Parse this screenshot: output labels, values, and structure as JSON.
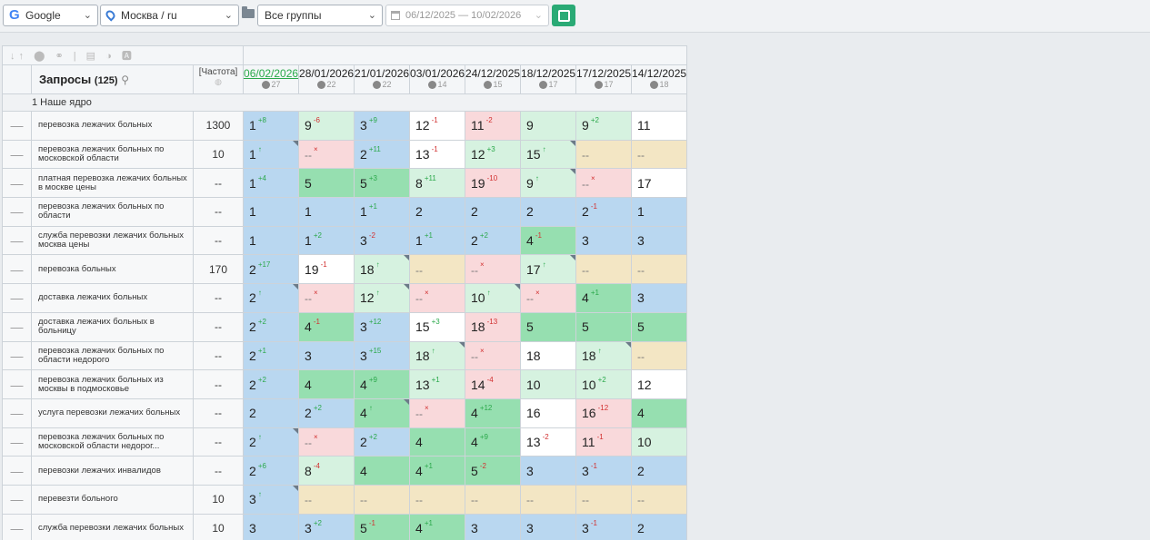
{
  "toolbar": {
    "engine": "Google",
    "region": "Москва / ru",
    "group": "Все группы",
    "date_range": "06/12/2025 — 10/02/2026"
  },
  "table": {
    "query_header": "Запросы",
    "query_count": "(125)",
    "freq_header": "[Частота]",
    "dates": [
      {
        "label": "06/02/2026",
        "count": "27"
      },
      {
        "label": "28/01/2026",
        "count": "22"
      },
      {
        "label": "21/01/2026",
        "count": "22"
      },
      {
        "label": "03/01/2026",
        "count": "14"
      },
      {
        "label": "24/12/2025",
        "count": "15"
      },
      {
        "label": "18/12/2025",
        "count": "17"
      },
      {
        "label": "17/12/2025",
        "count": "17"
      },
      {
        "label": "14/12/2025",
        "count": "18"
      }
    ],
    "group_name": "1 Наше ядро",
    "rows": [
      {
        "kw": "перевозка лежачих больных",
        "freq": "1300",
        "cells": [
          [
            "1",
            "+8",
            "up",
            "c-blue",
            0
          ],
          [
            "9",
            "-6",
            "down",
            "c-lgreen",
            0
          ],
          [
            "3",
            "+9",
            "up",
            "c-blue",
            0
          ],
          [
            "12",
            "-1",
            "down",
            "c-white",
            0
          ],
          [
            "11",
            "-2",
            "down",
            "c-pink",
            0
          ],
          [
            "9",
            "",
            "",
            "c-lgreen",
            0
          ],
          [
            "9",
            "+2",
            "up",
            "c-lgreen",
            0
          ],
          [
            "11",
            "",
            "",
            "c-white",
            0
          ]
        ]
      },
      {
        "kw": "перевозка лежачих больных по московской области",
        "freq": "10",
        "cells": [
          [
            "1",
            "↑",
            "up",
            "c-blue",
            1
          ],
          [
            "--",
            "×",
            "down",
            "c-pink",
            0
          ],
          [
            "2",
            "+11",
            "up",
            "c-blue",
            0
          ],
          [
            "13",
            "-1",
            "down",
            "c-white",
            0
          ],
          [
            "12",
            "+3",
            "up",
            "c-lgreen",
            0
          ],
          [
            "15",
            "↑",
            "up",
            "c-lgreen",
            1
          ],
          [
            "--",
            "",
            "",
            "c-beige",
            0
          ],
          [
            "--",
            "",
            "",
            "c-beige",
            0
          ]
        ]
      },
      {
        "kw": "платная перевозка лежачих больных в москве цены",
        "freq": "--",
        "cells": [
          [
            "1",
            "+4",
            "up",
            "c-blue",
            0
          ],
          [
            "5",
            "",
            "",
            "c-green",
            0
          ],
          [
            "5",
            "+3",
            "up",
            "c-green",
            0
          ],
          [
            "8",
            "+11",
            "up",
            "c-lgreen",
            0
          ],
          [
            "19",
            "-10",
            "down",
            "c-pink",
            0
          ],
          [
            "9",
            "↑",
            "up",
            "c-lgreen",
            1
          ],
          [
            "--",
            "×",
            "down",
            "c-pink",
            0
          ],
          [
            "17",
            "",
            "",
            "c-white",
            0
          ]
        ]
      },
      {
        "kw": "перевозка лежачих больных по области",
        "freq": "--",
        "cells": [
          [
            "1",
            "",
            "",
            "c-blue",
            0
          ],
          [
            "1",
            "",
            "",
            "c-blue",
            0
          ],
          [
            "1",
            "+1",
            "up",
            "c-blue",
            0
          ],
          [
            "2",
            "",
            "",
            "c-blue",
            0
          ],
          [
            "2",
            "",
            "",
            "c-blue",
            0
          ],
          [
            "2",
            "",
            "",
            "c-blue",
            0
          ],
          [
            "2",
            "-1",
            "down",
            "c-blue",
            0
          ],
          [
            "1",
            "",
            "",
            "c-blue",
            0
          ]
        ]
      },
      {
        "kw": "служба перевозки лежачих больных москва цены",
        "freq": "--",
        "cells": [
          [
            "1",
            "",
            "",
            "c-blue",
            0
          ],
          [
            "1",
            "+2",
            "up",
            "c-blue",
            0
          ],
          [
            "3",
            "-2",
            "down",
            "c-blue",
            0
          ],
          [
            "1",
            "+1",
            "up",
            "c-blue",
            0
          ],
          [
            "2",
            "+2",
            "up",
            "c-blue",
            0
          ],
          [
            "4",
            "-1",
            "down",
            "c-green",
            0
          ],
          [
            "3",
            "",
            "",
            "c-blue",
            0
          ],
          [
            "3",
            "",
            "",
            "c-blue",
            0
          ]
        ]
      },
      {
        "kw": "перевозка больных",
        "freq": "170",
        "cells": [
          [
            "2",
            "+17",
            "up",
            "c-blue",
            0
          ],
          [
            "19",
            "-1",
            "down",
            "c-white",
            0
          ],
          [
            "18",
            "↑",
            "up",
            "c-lgreen",
            1
          ],
          [
            "--",
            "",
            "",
            "c-beige",
            0
          ],
          [
            "--",
            "×",
            "down",
            "c-pink",
            0
          ],
          [
            "17",
            "↑",
            "up",
            "c-lgreen",
            1
          ],
          [
            "--",
            "",
            "",
            "c-beige",
            0
          ],
          [
            "--",
            "",
            "",
            "c-beige",
            0
          ]
        ]
      },
      {
        "kw": "доставка лежачих больных",
        "freq": "--",
        "cells": [
          [
            "2",
            "↑",
            "up",
            "c-blue",
            1
          ],
          [
            "--",
            "×",
            "down",
            "c-pink",
            0
          ],
          [
            "12",
            "↑",
            "up",
            "c-lgreen",
            1
          ],
          [
            "--",
            "×",
            "down",
            "c-pink",
            0
          ],
          [
            "10",
            "↑",
            "up",
            "c-lgreen",
            1
          ],
          [
            "--",
            "×",
            "down",
            "c-pink",
            0
          ],
          [
            "4",
            "+1",
            "up",
            "c-green",
            0
          ],
          [
            "3",
            "",
            "",
            "c-blue",
            0
          ]
        ]
      },
      {
        "kw": "доставка лежачих больных в больницу",
        "freq": "--",
        "cells": [
          [
            "2",
            "+2",
            "up",
            "c-blue",
            0
          ],
          [
            "4",
            "-1",
            "down",
            "c-green",
            0
          ],
          [
            "3",
            "+12",
            "up",
            "c-blue",
            0
          ],
          [
            "15",
            "+3",
            "up",
            "c-white",
            0
          ],
          [
            "18",
            "-13",
            "down",
            "c-pink",
            0
          ],
          [
            "5",
            "",
            "",
            "c-green",
            0
          ],
          [
            "5",
            "",
            "",
            "c-green",
            0
          ],
          [
            "5",
            "",
            "",
            "c-green",
            0
          ]
        ]
      },
      {
        "kw": "перевозка лежачих больных по области недорого",
        "freq": "--",
        "cells": [
          [
            "2",
            "+1",
            "up",
            "c-blue",
            0
          ],
          [
            "3",
            "",
            "",
            "c-blue",
            0
          ],
          [
            "3",
            "+15",
            "up",
            "c-blue",
            0
          ],
          [
            "18",
            "↑",
            "up",
            "c-lgreen",
            1
          ],
          [
            "--",
            "×",
            "down",
            "c-pink",
            0
          ],
          [
            "18",
            "",
            "",
            "c-white",
            0
          ],
          [
            "18",
            "↑",
            "up",
            "c-lgreen",
            1
          ],
          [
            "--",
            "",
            "",
            "c-beige",
            0
          ]
        ]
      },
      {
        "kw": "перевозка лежачих больных из москвы в подмосковье",
        "freq": "--",
        "cells": [
          [
            "2",
            "+2",
            "up",
            "c-blue",
            0
          ],
          [
            "4",
            "",
            "",
            "c-green",
            0
          ],
          [
            "4",
            "+9",
            "up",
            "c-green",
            0
          ],
          [
            "13",
            "+1",
            "up",
            "c-lgreen",
            0
          ],
          [
            "14",
            "-4",
            "down",
            "c-pink",
            0
          ],
          [
            "10",
            "",
            "",
            "c-lgreen",
            0
          ],
          [
            "10",
            "+2",
            "up",
            "c-lgreen",
            0
          ],
          [
            "12",
            "",
            "",
            "c-white",
            0
          ]
        ]
      },
      {
        "kw": "услуга перевозки лежачих больных",
        "freq": "--",
        "cells": [
          [
            "2",
            "",
            "",
            "c-blue",
            0
          ],
          [
            "2",
            "+2",
            "up",
            "c-blue",
            0
          ],
          [
            "4",
            "↑",
            "up",
            "c-green",
            1
          ],
          [
            "--",
            "×",
            "down",
            "c-pink",
            0
          ],
          [
            "4",
            "+12",
            "up",
            "c-green",
            0
          ],
          [
            "16",
            "",
            "",
            "c-white",
            0
          ],
          [
            "16",
            "-12",
            "down",
            "c-pink",
            0
          ],
          [
            "4",
            "",
            "",
            "c-green",
            0
          ]
        ]
      },
      {
        "kw": "перевозка лежачих больных по московской области недорог...",
        "freq": "--",
        "cells": [
          [
            "2",
            "↑",
            "up",
            "c-blue",
            1
          ],
          [
            "--",
            "×",
            "down",
            "c-pink",
            0
          ],
          [
            "2",
            "+2",
            "up",
            "c-blue",
            0
          ],
          [
            "4",
            "",
            "",
            "c-green",
            0
          ],
          [
            "4",
            "+9",
            "up",
            "c-green",
            0
          ],
          [
            "13",
            "-2",
            "down",
            "c-white",
            0
          ],
          [
            "11",
            "-1",
            "down",
            "c-pink",
            0
          ],
          [
            "10",
            "",
            "",
            "c-lgreen",
            0
          ]
        ]
      },
      {
        "kw": "перевозки лежачих инвалидов",
        "freq": "--",
        "cells": [
          [
            "2",
            "+6",
            "up",
            "c-blue",
            0
          ],
          [
            "8",
            "-4",
            "down",
            "c-lgreen",
            0
          ],
          [
            "4",
            "",
            "",
            "c-green",
            0
          ],
          [
            "4",
            "+1",
            "up",
            "c-green",
            0
          ],
          [
            "5",
            "-2",
            "down",
            "c-green",
            0
          ],
          [
            "3",
            "",
            "",
            "c-blue",
            0
          ],
          [
            "3",
            "-1",
            "down",
            "c-blue",
            0
          ],
          [
            "2",
            "",
            "",
            "c-blue",
            0
          ]
        ]
      },
      {
        "kw": "перевезти больного",
        "freq": "10",
        "cells": [
          [
            "3",
            "↑",
            "up",
            "c-blue",
            1
          ],
          [
            "--",
            "",
            "",
            "c-beige",
            0
          ],
          [
            "--",
            "",
            "",
            "c-beige",
            0
          ],
          [
            "--",
            "",
            "",
            "c-beige",
            0
          ],
          [
            "--",
            "",
            "",
            "c-beige",
            0
          ],
          [
            "--",
            "",
            "",
            "c-beige",
            0
          ],
          [
            "--",
            "",
            "",
            "c-beige",
            0
          ],
          [
            "--",
            "",
            "",
            "c-beige",
            0
          ]
        ]
      },
      {
        "kw": "служба перевозки лежачих больных",
        "freq": "10",
        "cells": [
          [
            "3",
            "",
            "",
            "c-blue",
            0
          ],
          [
            "3",
            "+2",
            "up",
            "c-blue",
            0
          ],
          [
            "5",
            "-1",
            "down",
            "c-green",
            0
          ],
          [
            "4",
            "+1",
            "up",
            "c-green",
            0
          ],
          [
            "3",
            "",
            "",
            "c-blue",
            0
          ],
          [
            "3",
            "",
            "",
            "c-blue",
            0
          ],
          [
            "3",
            "-1",
            "down",
            "c-blue",
            0
          ],
          [
            "2",
            "",
            "",
            "c-blue",
            0
          ]
        ]
      }
    ]
  }
}
